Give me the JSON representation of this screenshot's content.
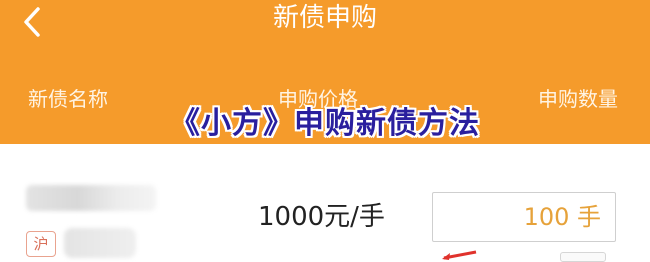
{
  "nav": {
    "title": "新债申购",
    "back_icon": "chevron-left-icon"
  },
  "table_header": {
    "name_label": "新债名称",
    "price_label": "申购价格",
    "qty_label": "申购数量"
  },
  "overlay": {
    "title": "《小方》申购新债方法"
  },
  "bond_row": {
    "market_badge": "沪",
    "price": "1000元/手",
    "quantity": "100 手"
  },
  "colors": {
    "accent": "#f59b2b",
    "quantity_text": "#e6a23a",
    "overlay_text": "#2a1f9e"
  }
}
